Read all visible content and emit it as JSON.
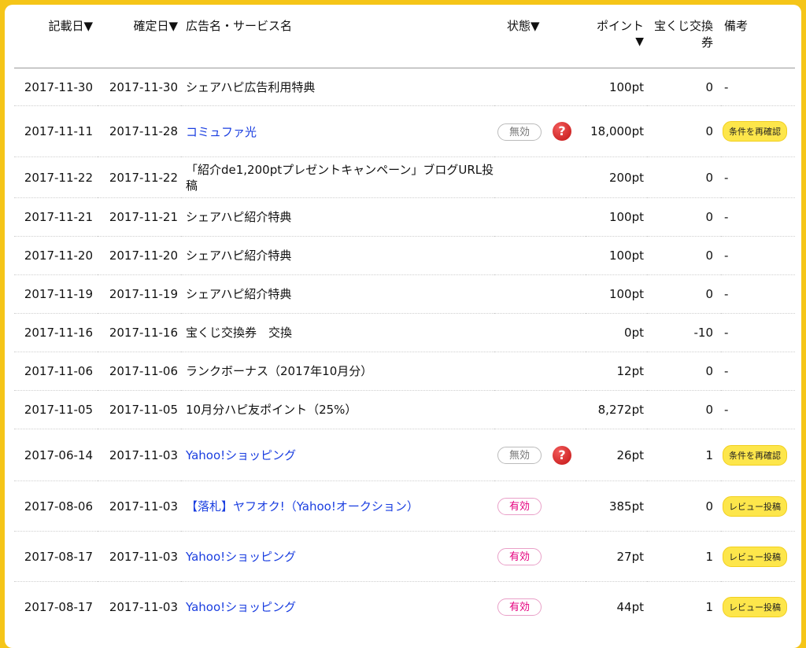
{
  "headers": {
    "record_date": "記載日▼",
    "confirm_date": "確定日▼",
    "ad_name": "広告名・サービス名",
    "status": "状態▼",
    "points": "ポイント",
    "points_sort": "▼",
    "lottery_line1": "宝くじ交換",
    "lottery_line2": "券",
    "remarks": "備考"
  },
  "rows": [
    {
      "record_date": "2017-11-30",
      "confirm_date": "2017-11-30",
      "name": "シェアハピ広告利用特典",
      "link": false,
      "status": "",
      "help": false,
      "points": "100pt",
      "lottery": "0",
      "remark": "-",
      "remark_button": false
    },
    {
      "record_date": "2017-11-11",
      "confirm_date": "2017-11-28",
      "name": "コミュファ光",
      "link": true,
      "status": "無効",
      "status_type": "invalid",
      "help": true,
      "points": "18,000pt",
      "lottery": "0",
      "remark": "条件を再確認",
      "remark_button": true
    },
    {
      "record_date": "2017-11-22",
      "confirm_date": "2017-11-22",
      "name": "「紹介de1,200ptプレゼントキャンペーン」ブログURL投稿",
      "link": false,
      "status": "",
      "help": false,
      "points": "200pt",
      "lottery": "0",
      "remark": "-",
      "remark_button": false
    },
    {
      "record_date": "2017-11-21",
      "confirm_date": "2017-11-21",
      "name": "シェアハピ紹介特典",
      "link": false,
      "status": "",
      "help": false,
      "points": "100pt",
      "lottery": "0",
      "remark": "-",
      "remark_button": false
    },
    {
      "record_date": "2017-11-20",
      "confirm_date": "2017-11-20",
      "name": "シェアハピ紹介特典",
      "link": false,
      "status": "",
      "help": false,
      "points": "100pt",
      "lottery": "0",
      "remark": "-",
      "remark_button": false
    },
    {
      "record_date": "2017-11-19",
      "confirm_date": "2017-11-19",
      "name": "シェアハピ紹介特典",
      "link": false,
      "status": "",
      "help": false,
      "points": "100pt",
      "lottery": "0",
      "remark": "-",
      "remark_button": false
    },
    {
      "record_date": "2017-11-16",
      "confirm_date": "2017-11-16",
      "name": "宝くじ交換券　交換",
      "link": false,
      "status": "",
      "help": false,
      "points": "0pt",
      "lottery": "-10",
      "remark": "-",
      "remark_button": false
    },
    {
      "record_date": "2017-11-06",
      "confirm_date": "2017-11-06",
      "name": "ランクボーナス（2017年10月分）",
      "link": false,
      "status": "",
      "help": false,
      "points": "12pt",
      "lottery": "0",
      "remark": "-",
      "remark_button": false
    },
    {
      "record_date": "2017-11-05",
      "confirm_date": "2017-11-05",
      "name": "10月分ハピ友ポイント（25%）",
      "link": false,
      "status": "",
      "help": false,
      "points": "8,272pt",
      "lottery": "0",
      "remark": "-",
      "remark_button": false
    },
    {
      "record_date": "2017-06-14",
      "confirm_date": "2017-11-03",
      "name": "Yahoo!ショッピング",
      "link": true,
      "status": "無効",
      "status_type": "invalid",
      "help": true,
      "points": "26pt",
      "lottery": "1",
      "remark": "条件を再確認",
      "remark_button": true
    },
    {
      "record_date": "2017-08-06",
      "confirm_date": "2017-11-03",
      "name": "【落札】ヤフオク!（Yahoo!オークション）",
      "link": true,
      "status": "有効",
      "status_type": "valid",
      "help": false,
      "points": "385pt",
      "lottery": "0",
      "remark": "レビュー投稿",
      "remark_button": true
    },
    {
      "record_date": "2017-08-17",
      "confirm_date": "2017-11-03",
      "name": "Yahoo!ショッピング",
      "link": true,
      "status": "有効",
      "status_type": "valid",
      "help": false,
      "points": "27pt",
      "lottery": "1",
      "remark": "レビュー投稿",
      "remark_button": true
    },
    {
      "record_date": "2017-08-17",
      "confirm_date": "2017-11-03",
      "name": "Yahoo!ショッピング",
      "link": true,
      "status": "有効",
      "status_type": "valid",
      "help": false,
      "points": "44pt",
      "lottery": "1",
      "remark": "レビュー投稿",
      "remark_button": true
    }
  ]
}
